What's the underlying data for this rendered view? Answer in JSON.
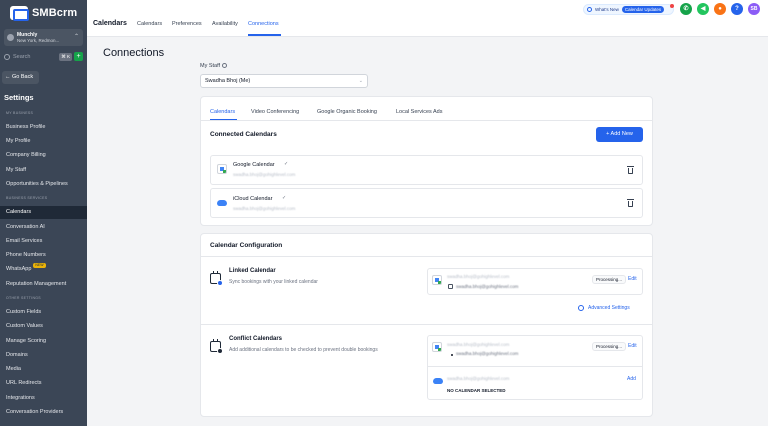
{
  "brand": {
    "name": "SMBcrm"
  },
  "location": {
    "name": "Munchly",
    "address": "New York, Redmon...",
    "chevron": "⌃"
  },
  "sidebar": {
    "search_placeholder": "Search",
    "search_shortcut": "⌘ K",
    "add_label": "+",
    "go_back": "← Go Back",
    "title": "Settings",
    "section_business": "MY BUSINESS",
    "section_services": "BUSINESS SERVICES",
    "section_other": "OTHER SETTINGS",
    "items": [
      {
        "label": "Business Profile"
      },
      {
        "label": "My Profile"
      },
      {
        "label": "Company Billing"
      },
      {
        "label": "My Staff"
      },
      {
        "label": "Opportunities & Pipelines"
      },
      {
        "label": "Calendars"
      },
      {
        "label": "Conversation AI"
      },
      {
        "label": "Email Services"
      },
      {
        "label": "Phone Numbers"
      },
      {
        "label": "WhatsApp",
        "badge": "NEW"
      },
      {
        "label": "Reputation Management"
      },
      {
        "label": "Custom Fields"
      },
      {
        "label": "Custom Values"
      },
      {
        "label": "Manage Scoring"
      },
      {
        "label": "Domains"
      },
      {
        "label": "Media"
      },
      {
        "label": "URL Redirects"
      },
      {
        "label": "Integrations"
      },
      {
        "label": "Conversation Providers"
      }
    ]
  },
  "header": {
    "title": "Calendars",
    "tabs": [
      "Calendars",
      "Preferences",
      "Availability",
      "Connections"
    ],
    "whats_new": "What's New",
    "calendar_updates": "Calendar Updates",
    "avatar_initials": "SB",
    "help": "?"
  },
  "main": {
    "page_title": "Connections",
    "my_staff_label": "My Staff",
    "staff_selected": "Swadha Bhoj (Me)",
    "tabs": [
      "Calendars",
      "Video Conferencing",
      "Google Organic Booking",
      "Local Services Ads"
    ],
    "connected_title": "Connected Calendars",
    "add_new": "+ Add New",
    "connected": [
      {
        "name": "Google Calendar",
        "email": "swadha.bhoj@gohighlevel.com"
      },
      {
        "name": "iCloud Calendar",
        "email": "swadha.bhoj@gohighlevel.com"
      }
    ],
    "config_title": "Calendar Configuration",
    "linked": {
      "title": "Linked Calendar",
      "desc": "Sync bookings with your linked calendar",
      "account": "swadha.bhoj@gohighlevel.com",
      "calendar": "swadha.bhoj@gohighlevel.com",
      "status": "Processing...",
      "edit": "Edit",
      "advanced": "Advanced Settings"
    },
    "conflict": {
      "title": "Conflict Calendars",
      "desc": "Add additional calendars to be checked to prevent double bookings",
      "account": "swadha.bhoj@gohighlevel.com",
      "calendar": "swadha.bhoj@gohighlevel.com",
      "status": "Processing...",
      "edit": "Edit",
      "icloud_account": "swadha.bhoj@gohighlevel.com",
      "add": "Add",
      "no_calendar": "NO CALENDAR SELECTED"
    }
  },
  "colors": {
    "accent": "#2563eb",
    "sidebar": "#3b4656",
    "sidebar_active": "#1f2937"
  },
  "icons": [
    "search-icon",
    "info-icon",
    "check-icon",
    "trash-icon",
    "gear-icon",
    "calendar-icon",
    "cloud-icon",
    "phone-icon",
    "megaphone-icon",
    "bell-icon"
  ]
}
